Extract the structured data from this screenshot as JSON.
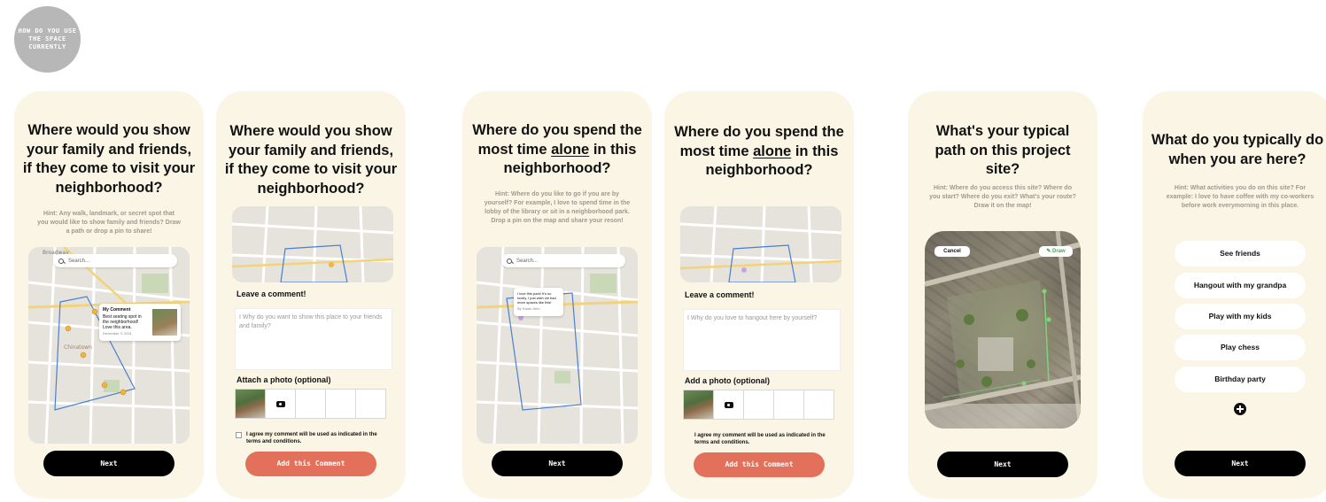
{
  "badge": {
    "text": "HOW DO YOU USE THE SPACE CURRENTLY"
  },
  "screens": [
    {
      "title": "Where would you show your family and friends, if they come to visit your neighborhood?",
      "hint": "Hint: Any walk, landmark, or secret spot that you would like to show family and friends? Draw a path or drop a pin to share!",
      "search_placeholder": "Search...",
      "popup": {
        "title": "My Comment",
        "text": "Best seating spot in the neighborhood! Love this area.",
        "date": "December 3, 2021"
      },
      "map_labels": [
        "Broadway",
        "Chinatown"
      ],
      "next_label": "Next"
    },
    {
      "title": "Where would you show your family and friends, if they come to visit your neighborhood?",
      "comment_label": "Leave a comment!",
      "comment_placeholder": "I Why do you want to show this place to your friends and family?",
      "photo_label": "Attach a photo (optional)",
      "agree_text": "I agree my comment will be used as indicated in the terms and conditions.",
      "add_label": "Add this Comment"
    },
    {
      "title_before": "Where do you spend the most time ",
      "title_emph": "alone",
      "title_after": " in this neighborhood?",
      "hint": "Hint: Where do you like to go if you are by yourself? For example, I love to spend time in the lobby of the library or sit in a neighborhood park. Drop a pin on the map and share your reson!",
      "search_placeholder": "Search...",
      "popup": {
        "text": "I love this park! It's so lovely. I just wish we had more spaces like this!",
        "author": "By Sarah Wen"
      },
      "next_label": "Next"
    },
    {
      "title_before": "Where do you spend the most time ",
      "title_emph": "alone",
      "title_after": " in this neighborhood?",
      "comment_label": "Leave a comment!",
      "comment_placeholder": "I Why do you love to hangout here by yourself?",
      "photo_label": "Add a photo (optional)",
      "agree_text": "I agree my comment will be used as indicated in the terms and conditions.",
      "add_label": "Add this Comment"
    },
    {
      "title": "What's your typical path on this project site?",
      "hint": "Hint: Where do you access this site? Where do you start? Where do you exit? What's your route? Draw it on the map!",
      "cancel_label": "Cancel",
      "draw_label": "Draw",
      "next_label": "Next"
    },
    {
      "title": "What do you typically do when you are here?",
      "hint": "Hint: What activities you do on this site? For example: I love to have coffee with my co-workers before work everymorning in this place.",
      "options": [
        "See friends",
        "Hangout with my grandpa",
        "Play with my kids",
        "Play chess",
        "Birthday party"
      ],
      "next_label": "Next"
    }
  ],
  "colors": {
    "card_bg": "#fbf5e5",
    "accent": "#e2705a",
    "button": "#000000",
    "route": "#4a7fd1",
    "pin": "#f0b53a"
  }
}
